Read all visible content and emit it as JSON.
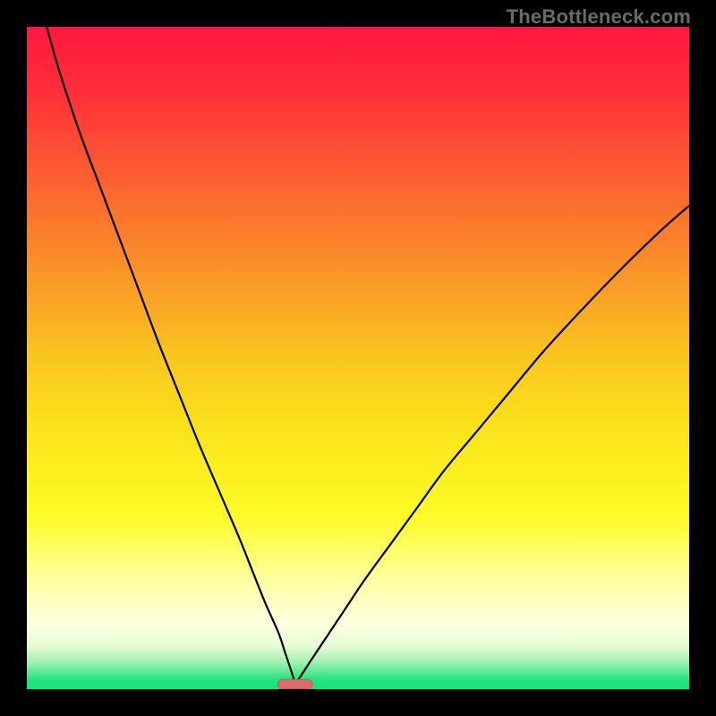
{
  "watermark": "TheBottleneck.com",
  "colors": {
    "frame": "#000000",
    "curve": "#000000",
    "marker_fill": "#db6b6c",
    "marker_stroke": "#cc5a5c",
    "gradient_stops": [
      {
        "offset": 0.0,
        "color": "#fe1740"
      },
      {
        "offset": 0.1,
        "color": "#fe3039"
      },
      {
        "offset": 0.22,
        "color": "#fc5c31"
      },
      {
        "offset": 0.35,
        "color": "#fa8c2a"
      },
      {
        "offset": 0.5,
        "color": "#f9c61f"
      },
      {
        "offset": 0.62,
        "color": "#fbe61b"
      },
      {
        "offset": 0.74,
        "color": "#fdfb28"
      },
      {
        "offset": 0.84,
        "color": "#feffa7"
      },
      {
        "offset": 0.905,
        "color": "#fcffe2"
      },
      {
        "offset": 0.935,
        "color": "#e5fcd2"
      },
      {
        "offset": 0.96,
        "color": "#9cf2b2"
      },
      {
        "offset": 0.985,
        "color": "#27e47f"
      },
      {
        "offset": 1.0,
        "color": "#19e17b"
      }
    ]
  },
  "chart_data": {
    "type": "line",
    "title": "",
    "xlabel": "",
    "ylabel": "",
    "xlim": [
      0,
      100
    ],
    "ylim": [
      0,
      100
    ],
    "minimum_x": 40.5,
    "marker": {
      "x_center": 40.5,
      "width": 5.2,
      "height": 1.4
    },
    "series": [
      {
        "name": "left-branch",
        "x": [
          3,
          5,
          8,
          11,
          14,
          17,
          20,
          23,
          26,
          29,
          32,
          34,
          36,
          38,
          39,
          40,
          40.5
        ],
        "y": [
          100,
          93,
          84,
          76,
          68,
          60,
          52,
          44.5,
          37,
          30,
          23,
          18,
          13,
          8.5,
          5.5,
          2.5,
          0.8
        ]
      },
      {
        "name": "right-branch",
        "x": [
          40.5,
          41.5,
          43,
          45,
          48,
          51,
          55,
          59,
          63,
          68,
          73,
          78,
          84,
          90,
          96,
          100
        ],
        "y": [
          0.8,
          2.2,
          4.5,
          7.5,
          12,
          16.5,
          22,
          27.5,
          33,
          39,
          45,
          51,
          57.5,
          63.7,
          69.5,
          73
        ]
      }
    ]
  }
}
